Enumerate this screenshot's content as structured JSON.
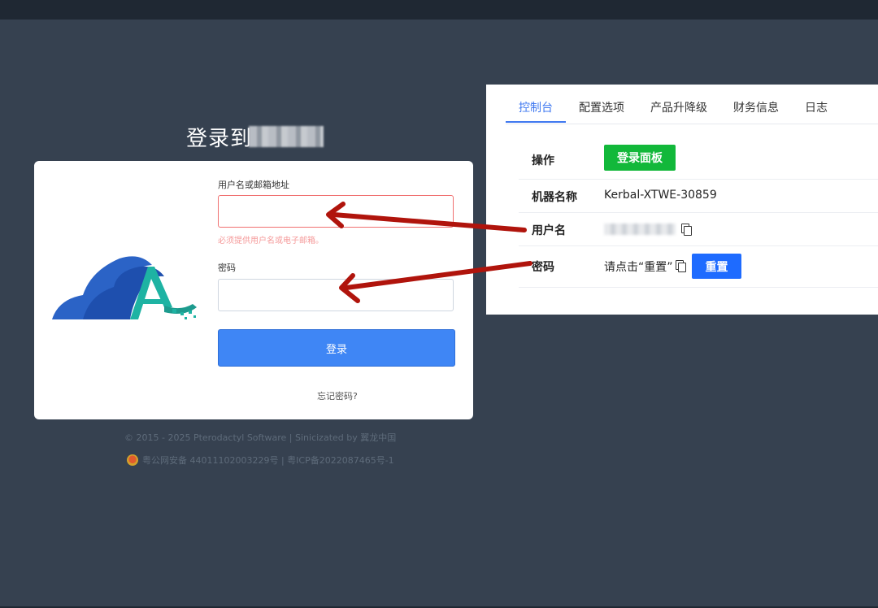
{
  "page": {
    "title": "登录到"
  },
  "login": {
    "username_label": "用户名或邮箱地址",
    "username_value": "",
    "username_error": "必须提供用户名或电子邮箱。",
    "password_label": "密码",
    "password_value": "",
    "submit_label": "登录",
    "forgot_link": "忘记密码?"
  },
  "footer": {
    "copyright": "© 2015 - 2025 Pterodactyl Software | Sinicizated by 翼龙中国",
    "icp": "粤公网安备 44011102003229号 | 粤ICP备2022087465号-1",
    "badge_icon": "police-badge-icon"
  },
  "panel": {
    "tabs": [
      "控制台",
      "配置选项",
      "产品升降级",
      "财务信息",
      "日志"
    ],
    "active_tab": "控制台",
    "rows": {
      "operation": {
        "key": "操作",
        "button": "登录面板"
      },
      "machine_name": {
        "key": "机器名称",
        "value": "Kerbal-XTWE-30859"
      },
      "username": {
        "key": "用户名"
      },
      "password": {
        "key": "密码",
        "value": "请点击“重置”",
        "button": "重置"
      }
    }
  },
  "colors": {
    "background": "#364150",
    "accent_blue": "#3f86f5",
    "green_button": "#12b83a",
    "reset_button": "#1e6bff",
    "error_red": "#f07070",
    "annotation_arrow": "#b0140c"
  }
}
